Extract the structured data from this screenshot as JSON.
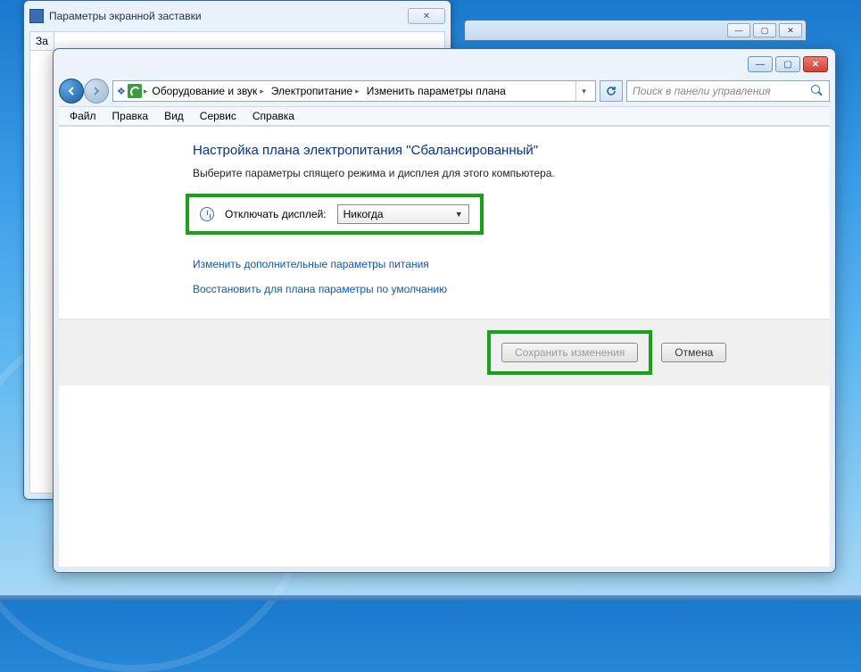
{
  "back_window": {
    "title": "Параметры экранной заставки",
    "tab_label": "За"
  },
  "farback_controls": {
    "min": "—",
    "max": "▢",
    "close": "✕"
  },
  "main_window": {
    "titlebar": {
      "min": "—",
      "max": "▢",
      "close": "✕"
    },
    "nav": {
      "crumbs": [
        "Оборудование и звук",
        "Электропитание",
        "Изменить параметры плана"
      ],
      "search_placeholder": "Поиск в панели управления"
    },
    "menu": [
      "Файл",
      "Правка",
      "Вид",
      "Сервис",
      "Справка"
    ],
    "page": {
      "title": "Настройка плана электропитания \"Сбалансированный\"",
      "subtitle": "Выберите параметры спящего режима и дисплея для этого компьютера.",
      "display_off_label": "Отключать дисплей:",
      "display_off_value": "Никогда",
      "link_advanced": "Изменить дополнительные параметры питания",
      "link_restore": "Восстановить для плана параметры по умолчанию",
      "save_btn": "Сохранить изменения",
      "cancel_btn": "Отмена"
    }
  },
  "colors": {
    "highlight": "#17a317",
    "link": "#0b57c7",
    "title": "#003399"
  }
}
